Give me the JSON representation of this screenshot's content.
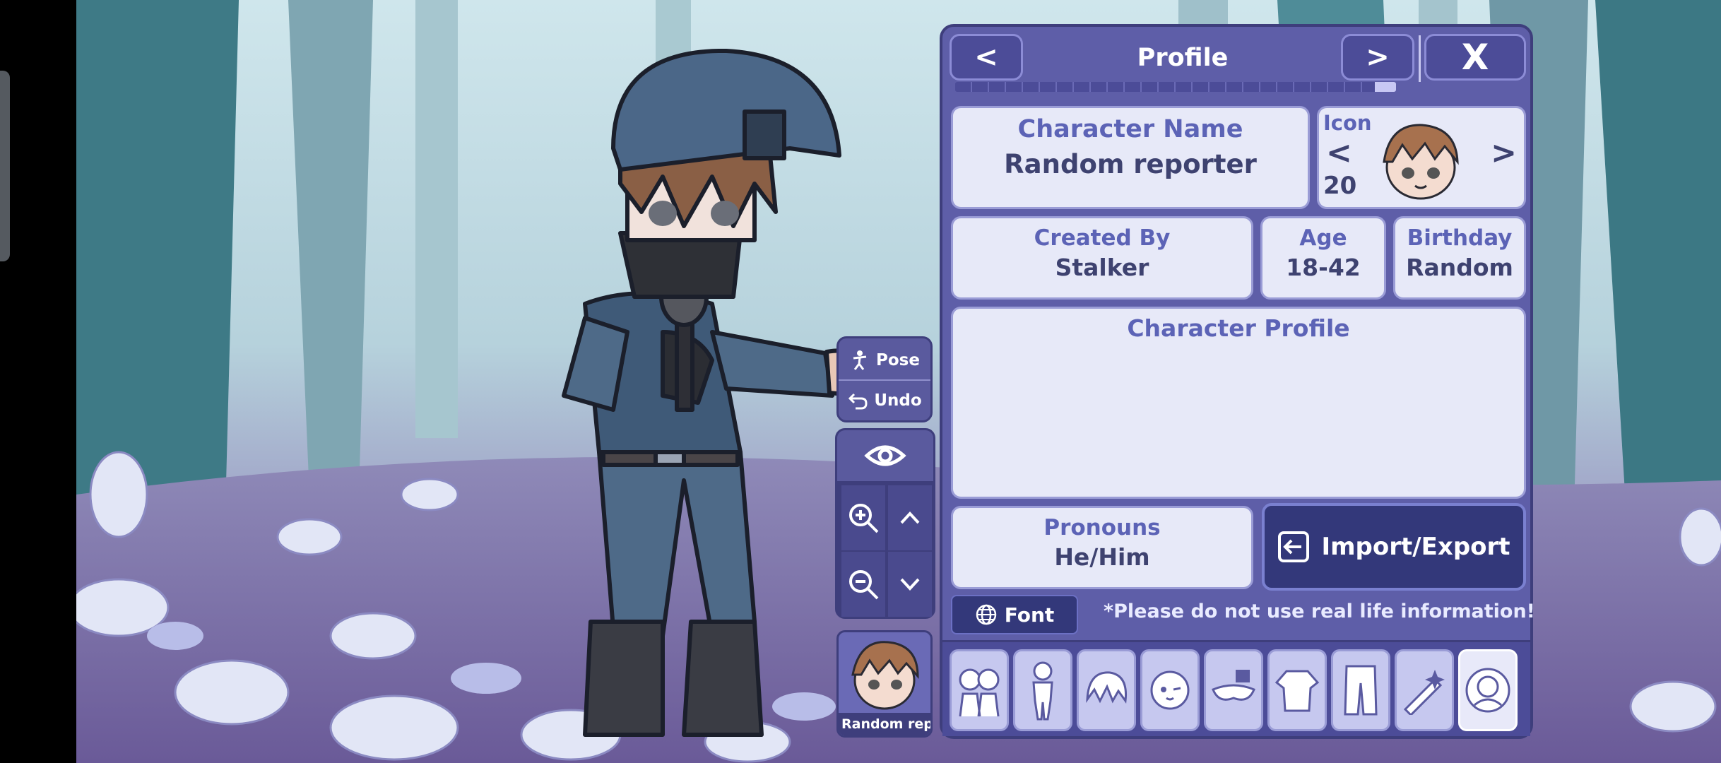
{
  "panel": {
    "title": "Profile",
    "prev_label": "<",
    "next_label": ">",
    "close_label": "X",
    "progress_fraction": 0.96
  },
  "character_name": {
    "caption": "Character Name",
    "value": "Random reporter"
  },
  "icon": {
    "caption": "Icon",
    "number": "20",
    "prev": "<",
    "next": ">"
  },
  "created_by": {
    "caption": "Created By",
    "value": "Stalker"
  },
  "age": {
    "caption": "Age",
    "value": "18-42"
  },
  "birthday": {
    "caption": "Birthday",
    "value": "Random"
  },
  "profile": {
    "caption": "Character Profile",
    "value": ""
  },
  "pronouns": {
    "caption": "Pronouns",
    "value": "He/Him"
  },
  "import_export_label": "Import/Export",
  "font_label": "Font",
  "warning_text": "*Please do not use real life information!",
  "tools": {
    "pose_label": "Pose",
    "undo_label": "Undo"
  },
  "thumbnail_label": "Random repor",
  "tabs": [
    {
      "icon": "group-presets-icon"
    },
    {
      "icon": "body-icon"
    },
    {
      "icon": "hair-icon"
    },
    {
      "icon": "face-icon"
    },
    {
      "icon": "accessories-icon"
    },
    {
      "icon": "top-clothing-icon"
    },
    {
      "icon": "bottom-clothing-icon"
    },
    {
      "icon": "props-icon"
    },
    {
      "icon": "profile-icon",
      "active": true
    }
  ],
  "colors": {
    "panel": "#5e5ea8",
    "card": "#e7e9f8",
    "caption": "#5c63b6",
    "value": "#3e4270",
    "button_dark": "#33387a"
  }
}
